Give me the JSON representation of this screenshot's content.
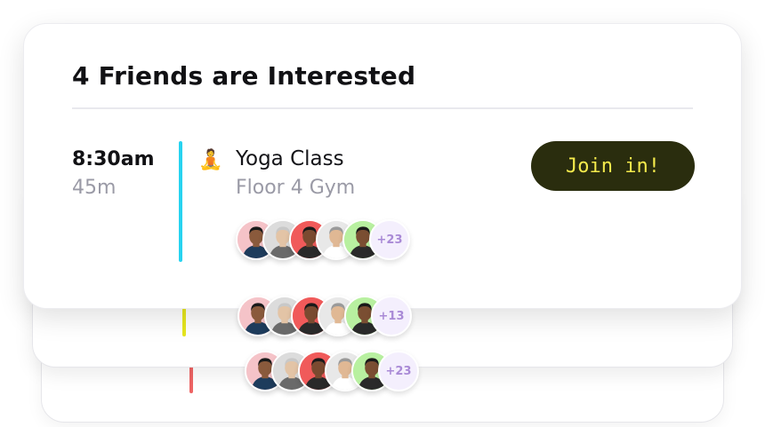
{
  "colors": {
    "accent_front": "#27d3f0",
    "accent_middle": "#e6e61e",
    "accent_back": "#ee6464",
    "button_bg": "#2a2d0e",
    "button_text": "#f4ea4c",
    "more_bg": "#f4effd",
    "more_text": "#a98ad6"
  },
  "front_card": {
    "title": "4 Friends are Interested",
    "time": "8:30am",
    "duration": "45m",
    "event_icon": "person-in-lotus-position-emoji",
    "event_emoji": "🧘",
    "event_title": "Yoga Class",
    "event_location": "Floor 4 Gym",
    "join_label": "Join in!",
    "more_count": "+23",
    "avatars": [
      {
        "bg": "#f5c3c8",
        "skin": "#8a5a3c",
        "hair": "#1a1a1a",
        "shirt": "#1e3c5c"
      },
      {
        "bg": "#dcdcdc",
        "skin": "#e3c4a6",
        "hair": "#c8c8c8",
        "shirt": "#6a6a6a"
      },
      {
        "bg": "#f05a5a",
        "skin": "#7a4a30",
        "hair": "#1a1a1a",
        "shirt": "#2a2a2a"
      },
      {
        "bg": "#e8e8e8",
        "skin": "#e0b894",
        "hair": "#9a9a9a",
        "shirt": "#ffffff"
      },
      {
        "bg": "#b8f0a0",
        "skin": "#7a4e32",
        "hair": "#1a1a1a",
        "shirt": "#2a2a2a"
      }
    ]
  },
  "middle_card": {
    "more_count": "+13"
  },
  "back_card": {
    "more_count": "+23"
  }
}
